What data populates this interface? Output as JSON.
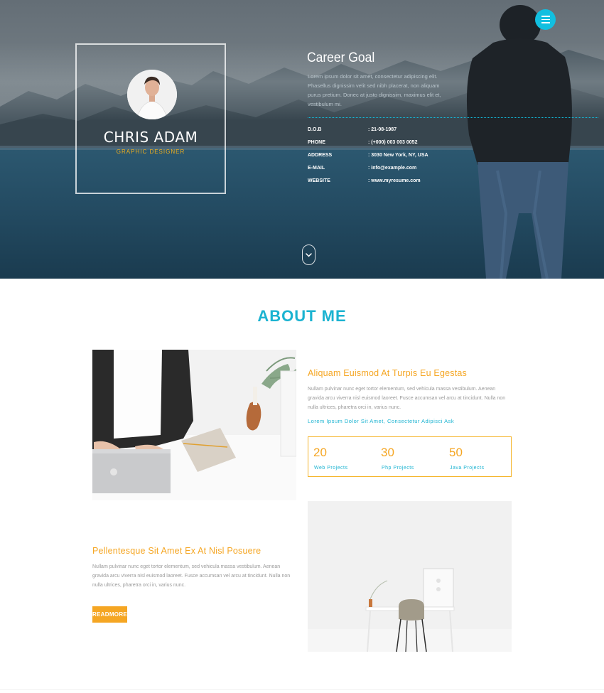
{
  "hero": {
    "menu_icon": "hamburger-menu-icon",
    "profile": {
      "name": "CHRIS ADAM",
      "role": "GRAPHIC DESIGNER"
    },
    "career": {
      "title": "Career Goal",
      "text": "Lorem ipsum dolor sit amet, consectetur adipiscing elit. Phasellus dignissim velit sed nibh placerat, non aliquam purus pretium. Donec at justo dignissim, maximus elit et, vestibulum mi."
    },
    "info": [
      {
        "label": "D.O.B",
        "value": ": 21-08-1987"
      },
      {
        "label": "PHONE",
        "value": ": (+000) 003 003 0052"
      },
      {
        "label": "ADDRESS",
        "value": ": 3030 New York, NY, USA"
      },
      {
        "label": "E-MAIL",
        "value": ":  info@example.com"
      },
      {
        "label": "WEBSITE",
        "value": ": www.myresume.com"
      }
    ],
    "scroll_icon": "chevron-down-icon",
    "accent_color": "#11bfe0"
  },
  "about": {
    "title": "ABOUT ME",
    "block1": {
      "heading": "Aliquam Euismod At Turpis Eu Egestas",
      "text": "Nullam pulvinar nunc eget tortor elementum, sed vehicula massa vestibulum. Aenean gravida arcu viverra nisl euismod laoreet. Fusce accumsan vel arcu at tincidunt. Nulla non nulla ultrices, pharetra orci in, varius nunc.",
      "link": "Lorem Ipsum Dolor Sit Amet, Consectetur Adipisci Ask"
    },
    "stats": [
      {
        "number": "20",
        "label": "Web Projects"
      },
      {
        "number": "30",
        "label": "Php Projects"
      },
      {
        "number": "50",
        "label": "Java Projects"
      }
    ],
    "block2": {
      "heading": "Pellentesque Sit Amet Ex At Nisl Posuere",
      "text": "Nullam pulvinar nunc eget tortor elementum, sed vehicula massa vestibulum. Aenean gravida arcu viverra nisl euismod laoreet. Fusce accumsan vel arcu at tincidunt. Nulla non nulla ultrices, pharetra orci in, varius nunc.",
      "button": "READMORE"
    },
    "colors": {
      "heading": "#1bb3d1",
      "accent": "#f5a623"
    }
  }
}
